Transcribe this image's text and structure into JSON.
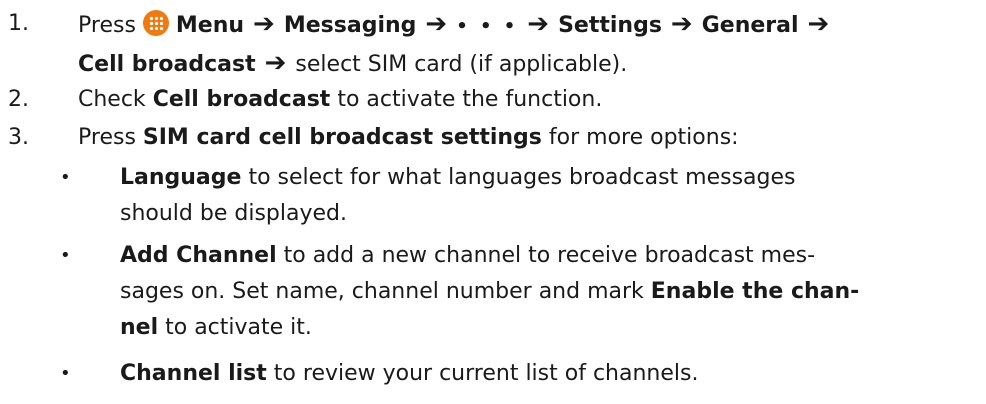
{
  "steps": [
    {
      "number": "1.",
      "press": "Press",
      "menu_icon": "menu-icon",
      "path": [
        "Menu",
        "Messaging",
        "Settings",
        "General",
        "Cell broadcast"
      ],
      "dots": "• • •",
      "tail": "select SIM card (if applicable)."
    },
    {
      "number": "2.",
      "prefix": "Check",
      "bold": "Cell broadcast",
      "suffix": "to activate the function."
    },
    {
      "number": "3.",
      "prefix": "Press",
      "bold": "SIM card cell broadcast settings",
      "suffix": "for more options:"
    }
  ],
  "bullets": [
    {
      "symbol": "•",
      "bold": "Language",
      "text_line1": "to select for what languages broadcast messages",
      "text_line2": "should be displayed."
    },
    {
      "symbol": "•",
      "bold": "Add Channel",
      "text_line1": "to add a new channel to receive broadcast mes-",
      "text_line2a": "sages on. Set name, channel number and mark",
      "bold2a": "Enable the chan-",
      "bold2b": "nel",
      "text_line3": "to activate it."
    },
    {
      "symbol": "•",
      "bold": "Channel list",
      "text": "to review your current list of channels."
    }
  ]
}
